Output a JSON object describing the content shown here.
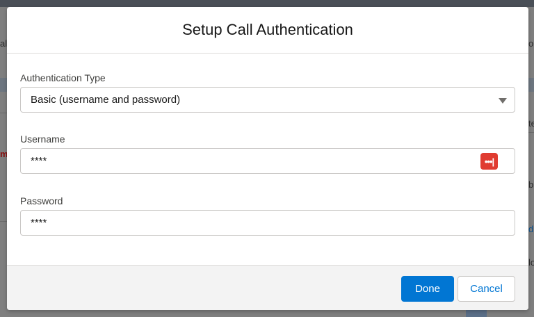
{
  "modal": {
    "title": "Setup Call Authentication",
    "auth_type": {
      "label": "Authentication Type",
      "value": "Basic (username and password)"
    },
    "username": {
      "label": "Username",
      "value": "****"
    },
    "password": {
      "label": "Password",
      "value": "****"
    },
    "footer": {
      "done_label": "Done",
      "cancel_label": "Cancel"
    },
    "password_manager_icon_glyph": "•••|"
  },
  "background": {
    "frag_left_1": "al",
    "frag_left_2": "m",
    "frag_right_1": "o",
    "frag_right_2": "te",
    "frag_right_3": "b",
    "frag_right_4": "d",
    "frag_right_5": "lo"
  },
  "colors": {
    "accent": "#0176d3",
    "password_icon": "#e03c31"
  }
}
